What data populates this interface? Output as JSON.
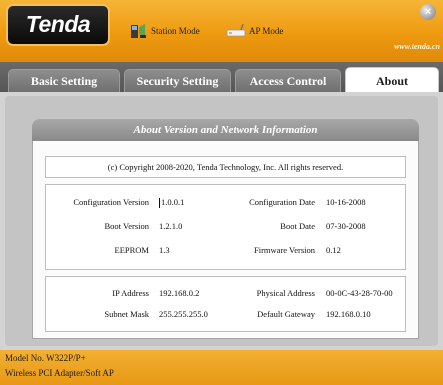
{
  "header": {
    "logo": "Tenda",
    "modes": [
      {
        "label": "Station Mode",
        "icon": "station-icon"
      },
      {
        "label": "AP Mode",
        "icon": "ap-icon"
      }
    ],
    "website": "www.tenda.cn",
    "close_icon": "close-icon"
  },
  "tabs": [
    {
      "label": "Basic Setting"
    },
    {
      "label": "Security Setting"
    },
    {
      "label": "Access Control"
    },
    {
      "label": "About",
      "active": true
    }
  ],
  "panel": {
    "title": "About Version and Network Information",
    "copyright": "(c) Copyright 2008-2020, Tenda Technology, Inc.  All rights reserved.",
    "info": [
      {
        "label": "Configuration Version",
        "value": "1.0.0.1",
        "label2": "Configuration Date",
        "value2": "10-16-2008"
      },
      {
        "label": "Boot Version",
        "value": "1.2.1.0",
        "label2": "Boot Date",
        "value2": "07-30-2008"
      },
      {
        "label": "EEPROM",
        "value": "1.3",
        "label2": "Firmware Version",
        "value2": "0.12"
      }
    ],
    "network": [
      {
        "label": "IP Address",
        "value": "192.168.0.2",
        "label2": "Physical Address",
        "value2": "00-0C-43-28-70-00"
      },
      {
        "label": "Subnet Mask",
        "value": "255.255.255.0",
        "label2": "Default Gateway",
        "value2": "192.168.0.10"
      }
    ]
  },
  "footer": {
    "model": "Model No.  W322P/P+",
    "product": "Wireless PCI Adapter/Soft AP"
  },
  "colors": {
    "header_orange": "#ee9a10",
    "tabbar_gray": "#5e5e5e",
    "panel_header_gray": "#989898",
    "footer_orange": "#eba222"
  }
}
